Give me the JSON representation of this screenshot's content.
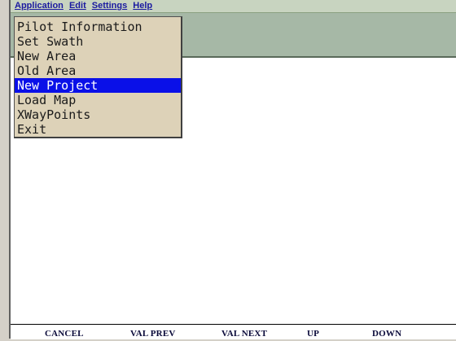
{
  "menubar": {
    "items": [
      "Application",
      "Edit",
      "Settings",
      "Help"
    ]
  },
  "dropdown": {
    "items": [
      "Pilot Information",
      "Set Swath",
      "New Area",
      "Old Area",
      "New Project",
      "Load Map",
      "XWayPoints",
      "Exit"
    ],
    "selected_index": 4
  },
  "statusbar": {
    "labels": [
      "CANCEL",
      "VAL PREV",
      "VAL NEXT",
      "UP",
      "DOWN"
    ]
  },
  "colors": {
    "menu_text": "#1a1aa0",
    "highlight": "#0a10e8",
    "dropdown_bg": "#ddd2b8",
    "panel_bg": "#a6b8a6"
  }
}
